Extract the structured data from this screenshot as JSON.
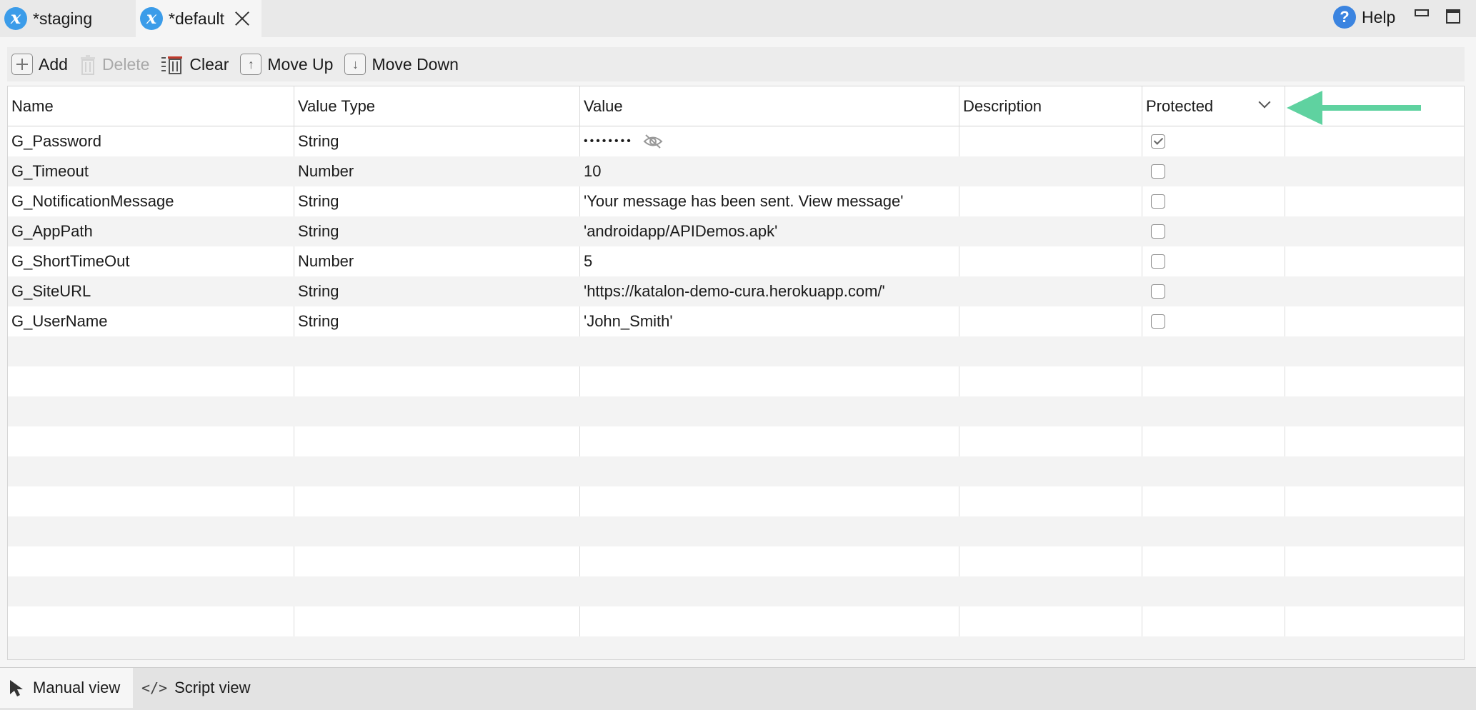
{
  "tabs": [
    {
      "label": "*staging",
      "icon": "x-variable-icon"
    },
    {
      "label": "*default",
      "icon": "x-variable-icon",
      "active": true
    }
  ],
  "help": {
    "label": "Help",
    "icon_glyph": "?"
  },
  "toolbar": {
    "add": "Add",
    "delete": "Delete",
    "clear": "Clear",
    "move_up": "Move Up",
    "move_down": "Move Down"
  },
  "table": {
    "columns": [
      "Name",
      "Value Type",
      "Value",
      "Description",
      "Protected"
    ],
    "rows": [
      {
        "name": "G_Password",
        "type": "String",
        "value": "••••••••",
        "description": "",
        "protected": true
      },
      {
        "name": "G_Timeout",
        "type": "Number",
        "value": "10",
        "description": "",
        "protected": false
      },
      {
        "name": "G_NotificationMessage",
        "type": "String",
        "value": "'Your message has been sent. View message'",
        "description": "",
        "protected": false
      },
      {
        "name": "G_AppPath",
        "type": "String",
        "value": "'androidapp/APIDemos.apk'",
        "description": "",
        "protected": false
      },
      {
        "name": "G_ShortTimeOut",
        "type": "Number",
        "value": "5",
        "description": "",
        "protected": false
      },
      {
        "name": "G_SiteURL",
        "type": "String",
        "value": "'https://katalon-demo-cura.herokuapp.com/'",
        "description": "",
        "protected": false
      },
      {
        "name": "G_UserName",
        "type": "String",
        "value": "'John_Smith'",
        "description": "",
        "protected": false
      }
    ]
  },
  "bottom_tabs": {
    "manual": "Manual view",
    "script": "Script view",
    "script_glyph": "</>"
  },
  "colors": {
    "accent_arrow": "#5fd2a0",
    "variable_icon": "#3b9ce9",
    "help_icon": "#3b84e0"
  }
}
